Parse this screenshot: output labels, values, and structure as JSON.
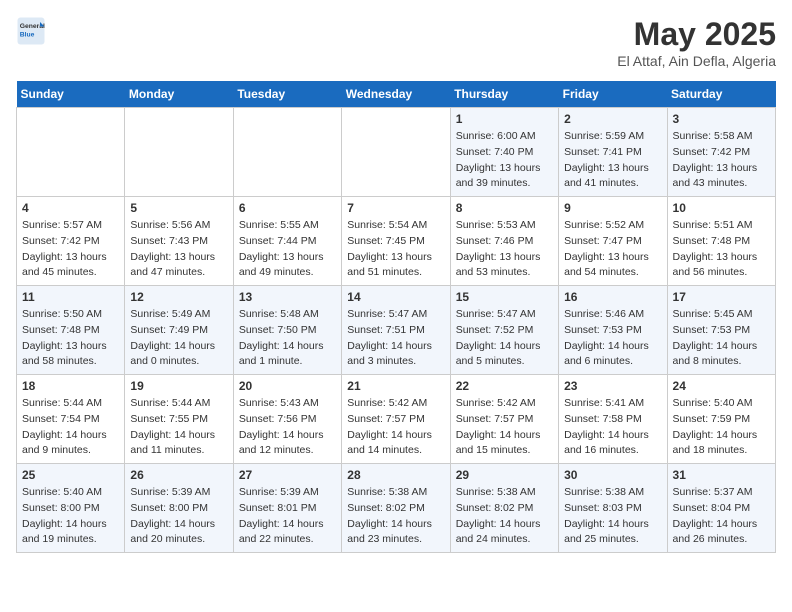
{
  "header": {
    "logo_general": "General",
    "logo_blue": "Blue",
    "title": "May 2025",
    "subtitle": "El Attaf, Ain Defla, Algeria"
  },
  "days_of_week": [
    "Sunday",
    "Monday",
    "Tuesday",
    "Wednesday",
    "Thursday",
    "Friday",
    "Saturday"
  ],
  "weeks": [
    [
      {
        "day": "",
        "info": ""
      },
      {
        "day": "",
        "info": ""
      },
      {
        "day": "",
        "info": ""
      },
      {
        "day": "",
        "info": ""
      },
      {
        "day": "1",
        "info": "Sunrise: 6:00 AM\nSunset: 7:40 PM\nDaylight: 13 hours\nand 39 minutes."
      },
      {
        "day": "2",
        "info": "Sunrise: 5:59 AM\nSunset: 7:41 PM\nDaylight: 13 hours\nand 41 minutes."
      },
      {
        "day": "3",
        "info": "Sunrise: 5:58 AM\nSunset: 7:42 PM\nDaylight: 13 hours\nand 43 minutes."
      }
    ],
    [
      {
        "day": "4",
        "info": "Sunrise: 5:57 AM\nSunset: 7:42 PM\nDaylight: 13 hours\nand 45 minutes."
      },
      {
        "day": "5",
        "info": "Sunrise: 5:56 AM\nSunset: 7:43 PM\nDaylight: 13 hours\nand 47 minutes."
      },
      {
        "day": "6",
        "info": "Sunrise: 5:55 AM\nSunset: 7:44 PM\nDaylight: 13 hours\nand 49 minutes."
      },
      {
        "day": "7",
        "info": "Sunrise: 5:54 AM\nSunset: 7:45 PM\nDaylight: 13 hours\nand 51 minutes."
      },
      {
        "day": "8",
        "info": "Sunrise: 5:53 AM\nSunset: 7:46 PM\nDaylight: 13 hours\nand 53 minutes."
      },
      {
        "day": "9",
        "info": "Sunrise: 5:52 AM\nSunset: 7:47 PM\nDaylight: 13 hours\nand 54 minutes."
      },
      {
        "day": "10",
        "info": "Sunrise: 5:51 AM\nSunset: 7:48 PM\nDaylight: 13 hours\nand 56 minutes."
      }
    ],
    [
      {
        "day": "11",
        "info": "Sunrise: 5:50 AM\nSunset: 7:48 PM\nDaylight: 13 hours\nand 58 minutes."
      },
      {
        "day": "12",
        "info": "Sunrise: 5:49 AM\nSunset: 7:49 PM\nDaylight: 14 hours\nand 0 minutes."
      },
      {
        "day": "13",
        "info": "Sunrise: 5:48 AM\nSunset: 7:50 PM\nDaylight: 14 hours\nand 1 minute."
      },
      {
        "day": "14",
        "info": "Sunrise: 5:47 AM\nSunset: 7:51 PM\nDaylight: 14 hours\nand 3 minutes."
      },
      {
        "day": "15",
        "info": "Sunrise: 5:47 AM\nSunset: 7:52 PM\nDaylight: 14 hours\nand 5 minutes."
      },
      {
        "day": "16",
        "info": "Sunrise: 5:46 AM\nSunset: 7:53 PM\nDaylight: 14 hours\nand 6 minutes."
      },
      {
        "day": "17",
        "info": "Sunrise: 5:45 AM\nSunset: 7:53 PM\nDaylight: 14 hours\nand 8 minutes."
      }
    ],
    [
      {
        "day": "18",
        "info": "Sunrise: 5:44 AM\nSunset: 7:54 PM\nDaylight: 14 hours\nand 9 minutes."
      },
      {
        "day": "19",
        "info": "Sunrise: 5:44 AM\nSunset: 7:55 PM\nDaylight: 14 hours\nand 11 minutes."
      },
      {
        "day": "20",
        "info": "Sunrise: 5:43 AM\nSunset: 7:56 PM\nDaylight: 14 hours\nand 12 minutes."
      },
      {
        "day": "21",
        "info": "Sunrise: 5:42 AM\nSunset: 7:57 PM\nDaylight: 14 hours\nand 14 minutes."
      },
      {
        "day": "22",
        "info": "Sunrise: 5:42 AM\nSunset: 7:57 PM\nDaylight: 14 hours\nand 15 minutes."
      },
      {
        "day": "23",
        "info": "Sunrise: 5:41 AM\nSunset: 7:58 PM\nDaylight: 14 hours\nand 16 minutes."
      },
      {
        "day": "24",
        "info": "Sunrise: 5:40 AM\nSunset: 7:59 PM\nDaylight: 14 hours\nand 18 minutes."
      }
    ],
    [
      {
        "day": "25",
        "info": "Sunrise: 5:40 AM\nSunset: 8:00 PM\nDaylight: 14 hours\nand 19 minutes."
      },
      {
        "day": "26",
        "info": "Sunrise: 5:39 AM\nSunset: 8:00 PM\nDaylight: 14 hours\nand 20 minutes."
      },
      {
        "day": "27",
        "info": "Sunrise: 5:39 AM\nSunset: 8:01 PM\nDaylight: 14 hours\nand 22 minutes."
      },
      {
        "day": "28",
        "info": "Sunrise: 5:38 AM\nSunset: 8:02 PM\nDaylight: 14 hours\nand 23 minutes."
      },
      {
        "day": "29",
        "info": "Sunrise: 5:38 AM\nSunset: 8:02 PM\nDaylight: 14 hours\nand 24 minutes."
      },
      {
        "day": "30",
        "info": "Sunrise: 5:38 AM\nSunset: 8:03 PM\nDaylight: 14 hours\nand 25 minutes."
      },
      {
        "day": "31",
        "info": "Sunrise: 5:37 AM\nSunset: 8:04 PM\nDaylight: 14 hours\nand 26 minutes."
      }
    ]
  ]
}
